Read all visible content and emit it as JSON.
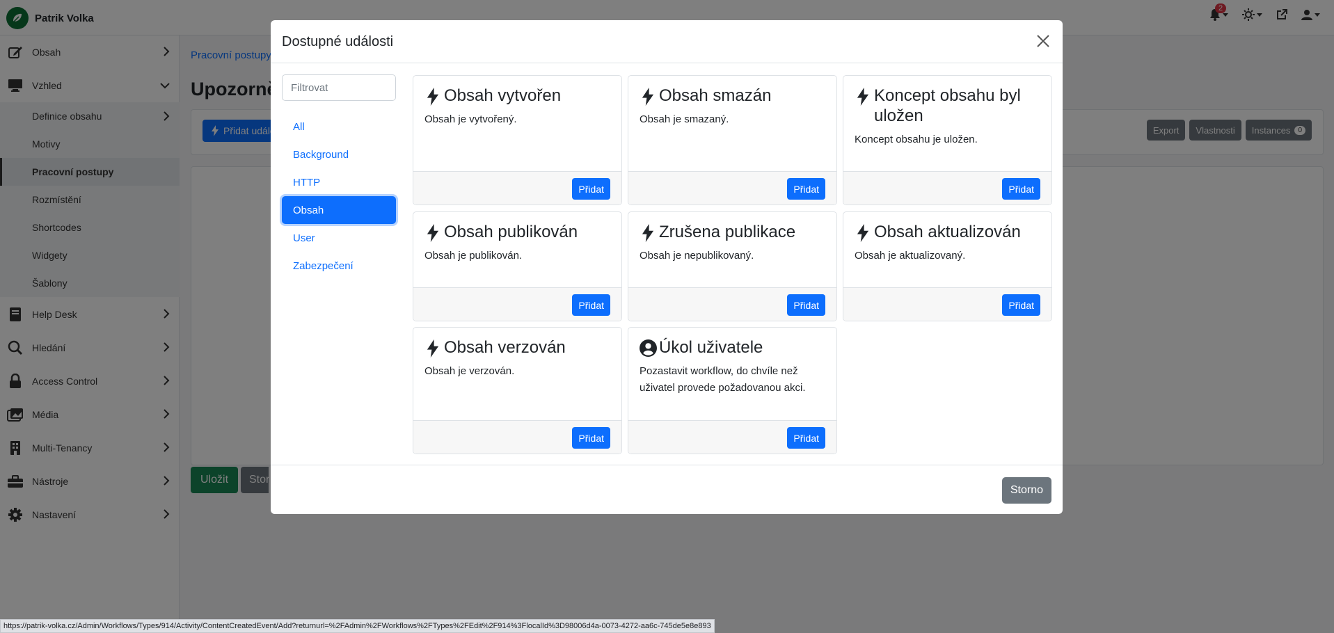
{
  "app": {
    "brand": "Patrik Volka",
    "notification_count": "2"
  },
  "sidebar": {
    "items": [
      {
        "label": "Obsah",
        "icon": "edit-icon"
      },
      {
        "label": "Vzhled",
        "icon": "monitor-icon"
      },
      {
        "label": "Help Desk",
        "icon": "book-icon"
      },
      {
        "label": "Hledání",
        "icon": "search-icon"
      },
      {
        "label": "Access Control",
        "icon": "lock-icon"
      },
      {
        "label": "Média",
        "icon": "images-icon"
      },
      {
        "label": "Multi-Tenancy",
        "icon": "building-icon"
      },
      {
        "label": "Nástroje",
        "icon": "toolbox-icon"
      },
      {
        "label": "Nastavení",
        "icon": "gear-icon"
      }
    ],
    "subitems": [
      {
        "label": "Definice obsahu"
      },
      {
        "label": "Motivy"
      },
      {
        "label": "Pracovní postupy"
      },
      {
        "label": "Rozmístění"
      },
      {
        "label": "Shortcodes"
      },
      {
        "label": "Widgety"
      },
      {
        "label": "Šablony"
      }
    ]
  },
  "main": {
    "breadcrumb": "Pracovní postupy",
    "title": "Upozornění",
    "add_event": "Přidat událost",
    "export": "Export",
    "properties": "Vlastnosti",
    "instances": "Instances",
    "instances_count": "0",
    "save": "Uložit",
    "cancel": "Storno"
  },
  "modal": {
    "title": "Dostupné události",
    "filter_placeholder": "Filtrovat",
    "categories": [
      "All",
      "Background",
      "HTTP",
      "Obsah",
      "User",
      "Zabezpečení"
    ],
    "active_category": "Obsah",
    "add_label": "Přidat",
    "cancel": "Storno",
    "events": [
      {
        "title": "Obsah vytvořen",
        "desc": "Obsah je vytvořený.",
        "icon": "bolt-icon"
      },
      {
        "title": "Obsah smazán",
        "desc": "Obsah je smazaný.",
        "icon": "bolt-icon"
      },
      {
        "title": "Koncept obsahu byl uložen",
        "desc": "Koncept obsahu je uložen.",
        "icon": "bolt-icon"
      },
      {
        "title": "Obsah publikován",
        "desc": "Obsah je publikován.",
        "icon": "bolt-icon"
      },
      {
        "title": "Zrušena publikace",
        "desc": "Obsah je nepublikovaný.",
        "icon": "bolt-icon"
      },
      {
        "title": "Obsah aktualizován",
        "desc": "Obsah je aktualizovaný.",
        "icon": "bolt-icon"
      },
      {
        "title": "Obsah verzován",
        "desc": "Obsah je verzován.",
        "icon": "bolt-icon"
      },
      {
        "title": "Úkol uživatele",
        "desc": "Pozastavit workflow, do chvíle než uživatel provede požadovanou akci.",
        "icon": "user-circle-icon"
      }
    ]
  },
  "statusbar": {
    "url": "https://patrik-volka.cz/Admin/Workflows/Types/914/Activity/ContentCreatedEvent/Add?returnurl=%2FAdmin%2FWorkflows%2FTypes%2FEdit%2F914%3FlocalId%3D98006d4a-0073-4272-aa6c-745de5e8e893"
  }
}
